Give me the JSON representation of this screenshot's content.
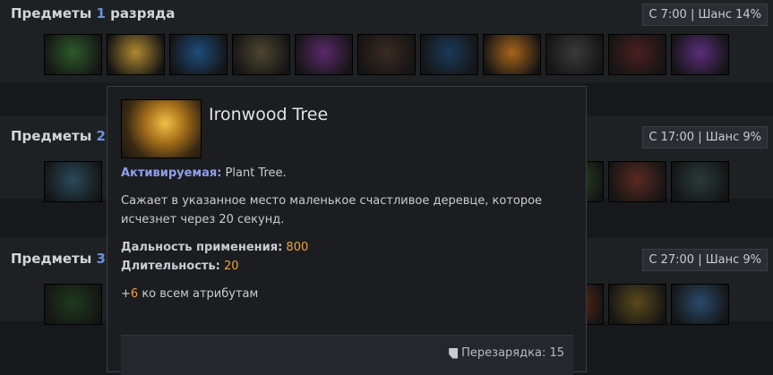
{
  "tiers": [
    {
      "title": "Предметы ",
      "num": "1",
      "rest": " разряда",
      "info": "С 7:00 | Шанс 14%"
    },
    {
      "title": "Предметы ",
      "num": "2",
      "rest": "",
      "info": "С 17:00 | Шанс 9%"
    },
    {
      "title": "Предметы ",
      "num": "3",
      "rest": "",
      "info": "С 27:00 | Шанс 9%"
    }
  ],
  "row1_items": [
    {
      "icon": "telescope-icon",
      "color": "#2e5a2a"
    },
    {
      "icon": "ironwood-tree-icon",
      "color": "#b08a30"
    },
    {
      "icon": "frost-crystal-icon",
      "color": "#1d4c7a"
    },
    {
      "icon": "broom-icon",
      "color": "#4c4530"
    },
    {
      "icon": "shovel-icon",
      "color": "#5a2a6a"
    },
    {
      "icon": "red-amulet-icon",
      "color": "#3a2a22"
    },
    {
      "icon": "blue-eye-icon",
      "color": "#1a3a5a"
    },
    {
      "icon": "honeycomb-icon",
      "color": "#a7651a"
    },
    {
      "icon": "armor-icon",
      "color": "#3a3a3a"
    },
    {
      "icon": "mask-icon",
      "color": "#4a1e20"
    },
    {
      "icon": "purple-crystal-icon",
      "color": "#5a2e7a"
    }
  ],
  "row2_left": [
    {
      "icon": "ring-icon",
      "color": "#2a4a5a"
    }
  ],
  "row2_right": [
    {
      "icon": "green-item-icon",
      "color": "#2a4a22"
    },
    {
      "icon": "whip-icon",
      "color": "#5a2a22"
    },
    {
      "icon": "silver-ring-icon",
      "color": "#2a3a3a"
    }
  ],
  "row3_left": [
    {
      "icon": "green-fish-icon",
      "color": "#1e3a1e"
    }
  ],
  "row3_right": [
    {
      "icon": "fire-item-icon",
      "color": "#6a2a14"
    },
    {
      "icon": "golden-armor-icon",
      "color": "#5a4a1a"
    },
    {
      "icon": "crown-icon",
      "color": "#2a4a6a"
    }
  ],
  "tooltip": {
    "name": "Ironwood Tree",
    "active_label": "Активируемая:",
    "active_text": " Plant Tree.",
    "desc": "Сажает в указанное место маленькое счастливое деревце, которое исчезнет через 20 секунд.",
    "range_label": "Дальность применения:",
    "range_value": "800",
    "duration_label": "Длительность:",
    "duration_value": "20",
    "attr_plus": "+",
    "attr_value": "6",
    "attr_text": " ко всем атрибутам",
    "cooldown": "Перезарядка: 15"
  }
}
